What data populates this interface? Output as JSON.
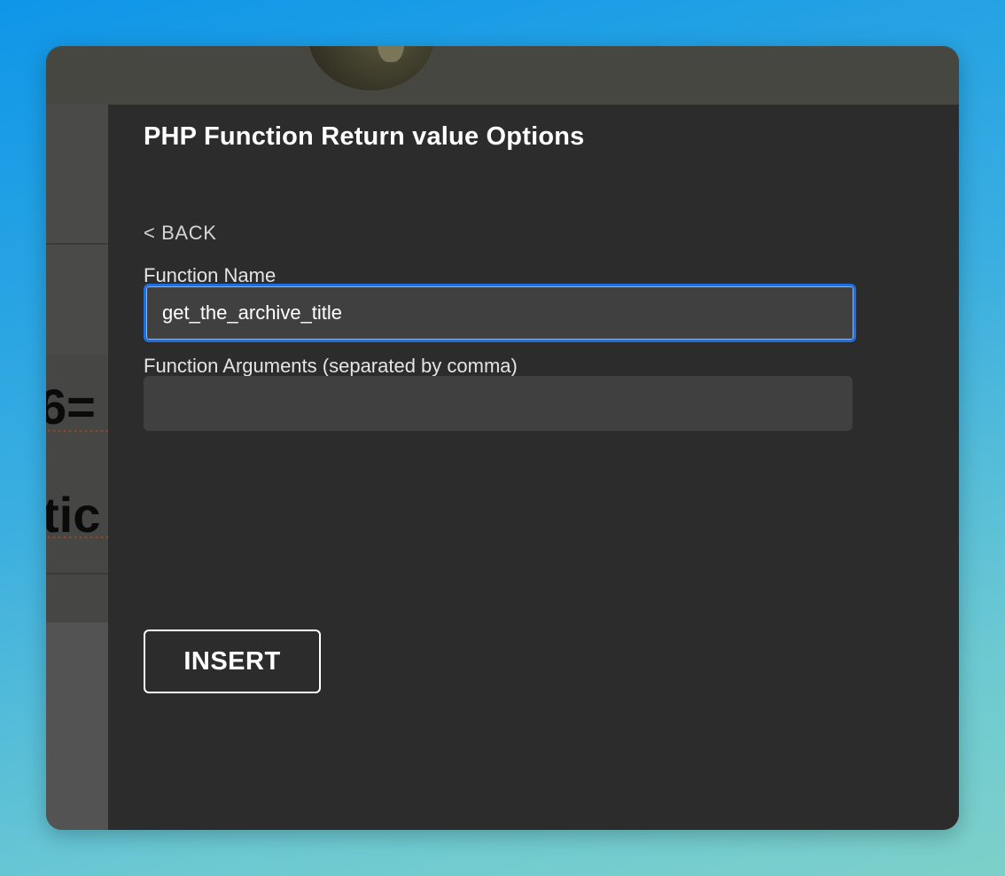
{
  "modal": {
    "title": "PHP Function Return value Options",
    "back_label": "< BACK",
    "function_name": {
      "label": "Function Name",
      "value": "get_the_archive_title",
      "placeholder": ""
    },
    "function_arguments": {
      "label": "Function Arguments (separated by comma)",
      "value": "",
      "placeholder": ""
    },
    "insert_label": "INSERT"
  },
  "background": {
    "text_fragment_1": "6=",
    "text_fragment_2": "tic"
  },
  "colors": {
    "modal_background": "#2c2c2c",
    "input_background": "#404040",
    "focus_border": "#1f6fe0",
    "desktop_gradient_top": "#0f96e8",
    "desktop_gradient_bottom": "#7dd0c9"
  }
}
